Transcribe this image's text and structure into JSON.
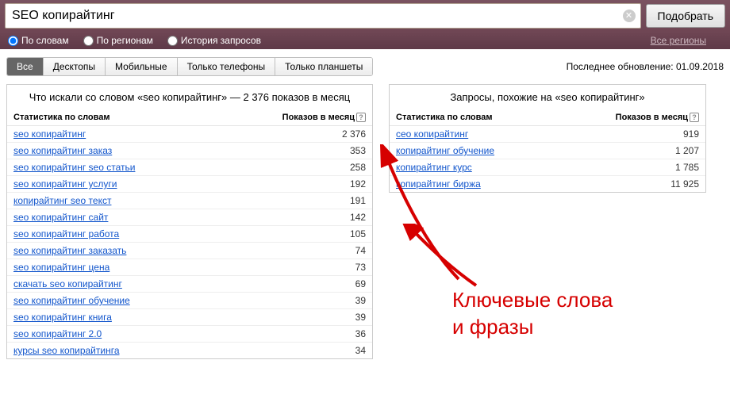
{
  "search": {
    "value": "SEO копирайтинг",
    "submit_label": "Подобрать"
  },
  "filters": {
    "by_words": "По словам",
    "by_regions": "По регионам",
    "history": "История запросов",
    "all_regions": "Все регионы"
  },
  "tabs": {
    "items": [
      "Все",
      "Десктопы",
      "Мобильные",
      "Только телефоны",
      "Только планшеты"
    ]
  },
  "update_info": "Последнее обновление: 01.09.2018",
  "left_panel": {
    "title": "Что искали со словом «seo копирайтинг» — 2 376 показов в месяц",
    "col_stat": "Статистика по словам",
    "col_views": "Показов в месяц",
    "rows": [
      {
        "term": "seo копирайтинг",
        "views": "2 376"
      },
      {
        "term": "seo копирайтинг заказ",
        "views": "353"
      },
      {
        "term": "seo копирайтинг seo статьи",
        "views": "258"
      },
      {
        "term": "seo копирайтинг услуги",
        "views": "192"
      },
      {
        "term": "копирайтинг seo текст",
        "views": "191"
      },
      {
        "term": "seo копирайтинг сайт",
        "views": "142"
      },
      {
        "term": "seo копирайтинг работа",
        "views": "105"
      },
      {
        "term": "seo копирайтинг заказать",
        "views": "74"
      },
      {
        "term": "seo копирайтинг цена",
        "views": "73"
      },
      {
        "term": "скачать seo копирайтинг",
        "views": "69"
      },
      {
        "term": "seo копирайтинг обучение",
        "views": "39"
      },
      {
        "term": "seo копирайтинг книга",
        "views": "39"
      },
      {
        "term": "seo копирайтинг 2.0",
        "views": "36"
      },
      {
        "term": "курсы seo копирайтинга",
        "views": "34"
      }
    ]
  },
  "right_panel": {
    "title": "Запросы, похожие на «seo копирайтинг»",
    "col_stat": "Статистика по словам",
    "col_views": "Показов в месяц",
    "rows": [
      {
        "term": "сео копирайтинг",
        "views": "919"
      },
      {
        "term": "копирайтинг обучение",
        "views": "1 207"
      },
      {
        "term": "копирайтинг курс",
        "views": "1 785"
      },
      {
        "term": "копирайтинг биржа",
        "views": "11 925"
      }
    ]
  },
  "annotation": {
    "line1": "Ключевые слова",
    "line2": "и фразы"
  }
}
